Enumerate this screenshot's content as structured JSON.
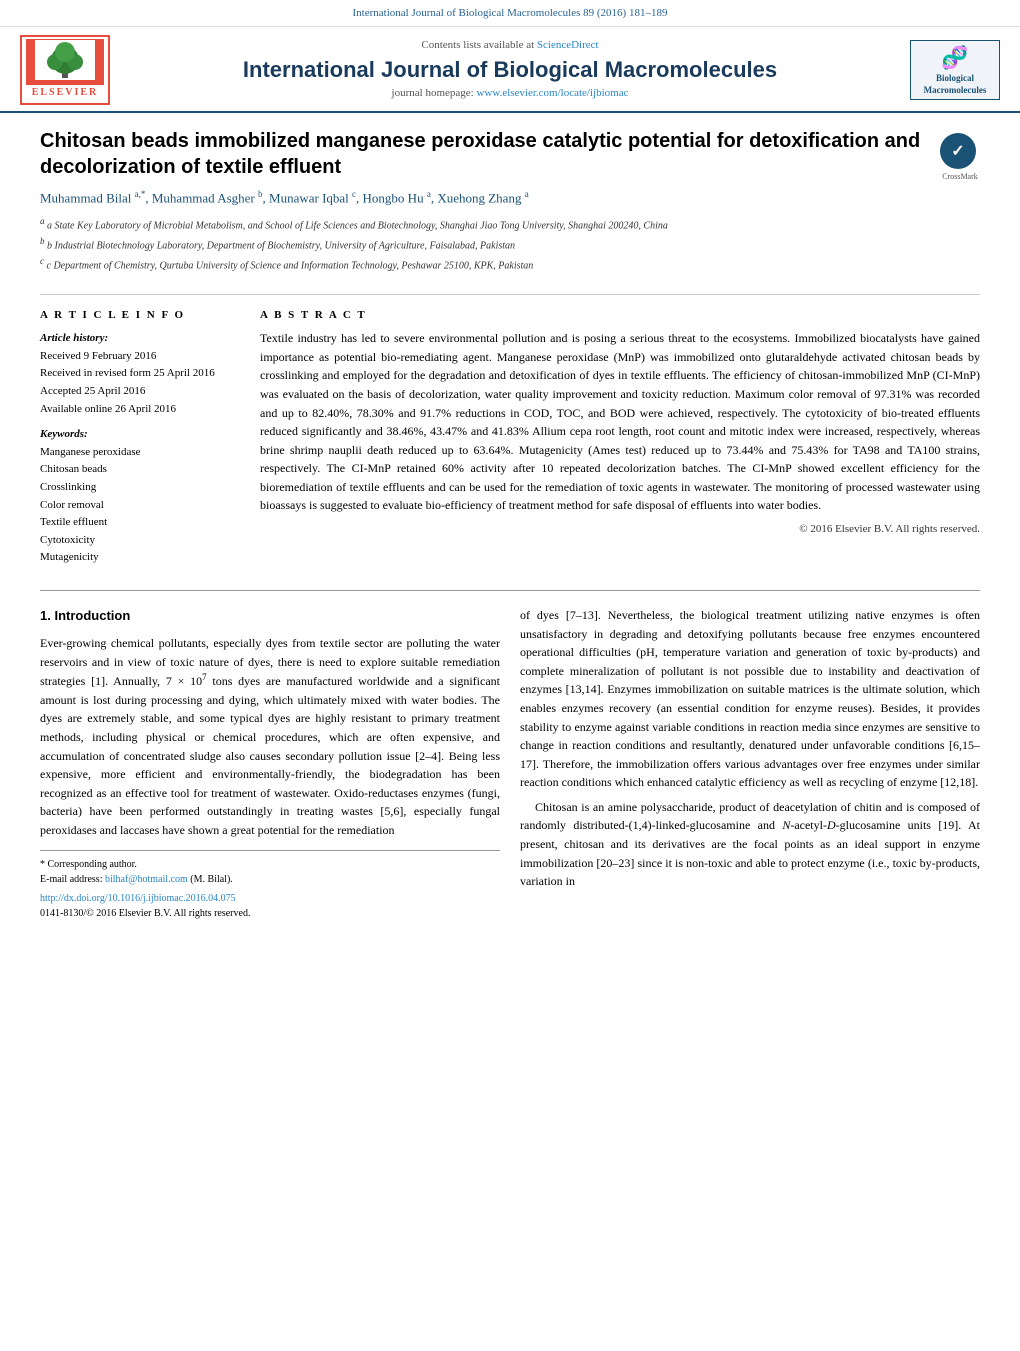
{
  "banner": {
    "text": "International Journal of Biological Macromolecules 89 (2016) 181–189"
  },
  "header": {
    "contents_label": "Contents lists available at ",
    "contents_link": "ScienceDirect",
    "journal_title": "International Journal of Biological Macromolecules",
    "homepage_label": "journal homepage: ",
    "homepage_link": "www.elsevier.com/locate/ijbiomac",
    "elsevier_text": "ELSEVIER",
    "bio_logo_line1": "Biological",
    "bio_logo_line2": "Macromolecules"
  },
  "article": {
    "title": "Chitosan beads immobilized manganese peroxidase catalytic potential for detoxification and decolorization of textile effluent",
    "authors": "Muhammad Bilal a,*, Muhammad Asgher b, Munawar Iqbal c, Hongbo Hu a, Xuehong Zhang a",
    "affiliations": [
      "a State Key Laboratory of Microbial Metabolism, and School of Life Sciences and Biotechnology, Shanghai Jiao Tong University, Shanghai 200240, China",
      "b Industrial Biotechnology Laboratory, Department of Biochemistry, University of Agriculture, Faisalabad, Pakistan",
      "c Department of Chemistry, Qurtuba University of Science and Information Technology, Peshawar 25100, KPK, Pakistan"
    ],
    "article_info": {
      "header": "A R T I C L E   I N F O",
      "history_label": "Article history:",
      "received": "Received 9 February 2016",
      "revised": "Received in revised form 25 April 2016",
      "accepted": "Accepted 25 April 2016",
      "available": "Available online 26 April 2016",
      "keywords_label": "Keywords:",
      "keywords": [
        "Manganese peroxidase",
        "Chitosan beads",
        "Crosslinking",
        "Color removal",
        "Textile effluent",
        "Cytotoxicity",
        "Mutagenicity"
      ]
    },
    "abstract": {
      "header": "A B S T R A C T",
      "text": "Textile industry has led to severe environmental pollution and is posing a serious threat to the ecosystems. Immobilized biocatalysts have gained importance as potential bio-remediating agent. Manganese peroxidase (MnP) was immobilized onto glutaraldehyde activated chitosan beads by crosslinking and employed for the degradation and detoxification of dyes in textile effluents. The efficiency of chitosan-immobilized MnP (CI-MnP) was evaluated on the basis of decolorization, water quality improvement and toxicity reduction. Maximum color removal of 97.31% was recorded and up to 82.40%, 78.30% and 91.7% reductions in COD, TOC, and BOD were achieved, respectively. The cytotoxicity of bio-treated effluents reduced significantly and 38.46%, 43.47% and 41.83% Allium cepa root length, root count and mitotic index were increased, respectively, whereas brine shrimp nauplii death reduced up to 63.64%. Mutagenicity (Ames test) reduced up to 73.44% and 75.43% for TA98 and TA100 strains, respectively. The CI-MnP retained 60% activity after 10 repeated decolorization batches. The CI-MnP showed excellent efficiency for the bioremediation of textile effluents and can be used for the remediation of toxic agents in wastewater. The monitoring of processed wastewater using bioassays is suggested to evaluate bio-efficiency of treatment method for safe disposal of effluents into water bodies.",
      "copyright": "© 2016 Elsevier B.V. All rights reserved."
    }
  },
  "body": {
    "section1": {
      "heading": "1.  Introduction",
      "col1_paragraphs": [
        "Ever-growing chemical pollutants, especially dyes from textile sector are polluting the water reservoirs and in view of toxic nature of dyes, there is need to explore suitable remediation strategies [1]. Annually, 7 × 10⁷ tons dyes are manufactured worldwide and a significant amount is lost during processing and dying, which ultimately mixed with water bodies. The dyes are extremely stable, and some typical dyes are highly resistant to primary treatment methods, including physical or chemical procedures, which are often expensive, and accumulation of concentrated sludge also causes secondary pollution issue [2–4]. Being less expensive, more efficient and environmentally-friendly, the biodegradation has been recognized as an effective tool for treatment of wastewater. Oxido-reductases enzymes (fungi, bacteria) have been performed outstandingly in treating wastes [5,6], especially fungal peroxidases and laccases have shown a great potential for the remediation of dyes [7–13]. Nevertheless, the biological treatment utilizing native enzymes is often unsatisfactory in degrading and detoxifying pollutants because free enzymes encountered operational difficulties (pH, temperature variation and generation of toxic by-products) and complete mineralization of pollutant is not possible due to instability and deactivation of enzymes [13,14]. Enzymes immobilization on suitable matrices is the ultimate solution, which enables enzymes recovery (an essential condition for enzyme reuses). Besides, it provides stability to enzyme against variable conditions in reaction media since enzymes are sensitive to change in reaction conditions and resultantly, denatured under unfavorable conditions [6,15–17]. Therefore, the immobilization offers various advantages over free enzymes under similar reaction conditions which enhanced catalytic efficiency as well as recycling of enzyme [12,18]."
      ],
      "col2_paragraphs": [
        "Chitosan is an amine polysaccharide, product of deacetylation of chitin and is composed of randomly distributed-(1,4)-linked-glucosamine and N-acetyl-D-glucosamine units [19]. At present, chitosan and its derivatives are the focal points as an ideal support in enzyme immobilization [20–23] since it is non-toxic and able to protect enzyme (i.e., toxic by-products, variation in"
      ]
    }
  },
  "footnote": {
    "corresponding_label": "* Corresponding author.",
    "email_label": "E-mail address: ",
    "email": "bilhaf@hotmail.com",
    "email_name": "(M. Bilal).",
    "doi": "http://dx.doi.org/10.1016/j.ijbiomac.2016.04.075",
    "issn": "0141-8130/© 2016 Elsevier B.V. All rights reserved."
  }
}
